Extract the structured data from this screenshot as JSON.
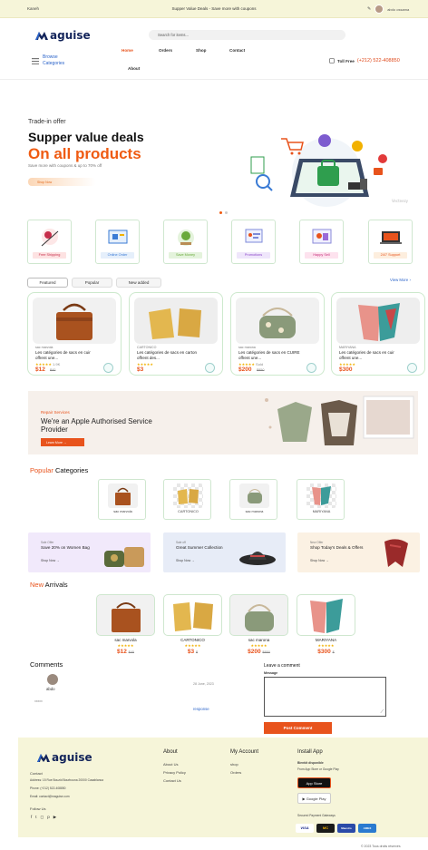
{
  "topbar": {
    "language": "Kaneh",
    "promo": "Supper Value Deals - Save more with coupons",
    "user_name": "abdo ossama"
  },
  "header": {
    "brand": "aguise",
    "search_placeholder": "Search for items...",
    "browse_label": "Browse Categories",
    "nav": [
      "Home",
      "Orders",
      "Shop",
      "Contact",
      "About"
    ],
    "toll_label": "Toll Free",
    "toll_number": "(+212) 522-408850"
  },
  "hero": {
    "eyebrow": "Trade-in offer",
    "title": "Supper value deals",
    "highlight": "On all products",
    "subtitle": "Save more with coupons & up to 70% off",
    "button": "Shop Now",
    "watermark": "Vecteezy"
  },
  "services": [
    "Free Shipping",
    "Online Order",
    "Save Money",
    "Promotions",
    "Happy Sell",
    "24/7 Support"
  ],
  "tabs": [
    "Featured",
    "Popular",
    "New added"
  ],
  "view_more": "View More",
  "products": [
    {
      "brand": "sac marvola",
      "name": "Les catégories de sacs en cuir offrent une...",
      "rating": "1.9K",
      "price": "$12",
      "old_price": "$40"
    },
    {
      "brand": "CARTONICO",
      "name": "Les catégories de sacs en carton offrent des...",
      "rating": "",
      "price": "$3",
      "old_price": ""
    },
    {
      "brand": "sac marona",
      "name": "Les catégories de sacs en CUIRE offrent une...",
      "rating": "Sold",
      "price": "$200",
      "old_price": "$850"
    },
    {
      "brand": "MARIYANA",
      "name": "Les catégories de sacs en cuir offrent une...",
      "rating": "",
      "price": "$300",
      "old_price": ""
    }
  ],
  "banner": {
    "eyebrow": "Repair Services",
    "title": "We're an Apple Authorised Service Provider",
    "button": "Learn More"
  },
  "popular": {
    "accent": "Popular",
    "rest": " Categories",
    "items": [
      "sac marvola",
      "CARTONICO",
      "sac marona",
      "MARIYANA"
    ]
  },
  "promos": [
    {
      "eyebrow": "Sale Offer",
      "title": "Save 20% on Women Bag",
      "link": "Shop Now"
    },
    {
      "eyebrow": "Sale off",
      "title": "Great Summer Collection",
      "link": "Shop Now"
    },
    {
      "eyebrow": "New Offer",
      "title": "Shop Today's Deals & Offers",
      "link": "Shop Now"
    }
  ],
  "arrivals": {
    "accent": "New",
    "rest": " Arrivals",
    "items": [
      {
        "name": "sac marvola",
        "price": "$12",
        "old": "$40"
      },
      {
        "name": "CARTONICO",
        "price": "$3",
        "old": "$"
      },
      {
        "name": "sac marona",
        "price": "$200",
        "old": "$850"
      },
      {
        "name": "MARIYANA",
        "price": "$300",
        "old": "$"
      }
    ]
  },
  "comments": {
    "title": "Comments",
    "author": "abdo",
    "date": "28 June, 2023",
    "text": "xxxxx",
    "reply": "response"
  },
  "leave_comment": {
    "title": "Leave a comment",
    "message_label": "Message",
    "button": "Post Comment"
  },
  "footer": {
    "brand": "aguise",
    "contact_h": "Contact",
    "address": "Address: 15 Rue Bouzid Bourbouna 20000 Casablanca",
    "phone": "Phone: (+212) 522-408850",
    "email": "Email: contact@maguise.com",
    "follow": "Follow Us",
    "about_h": "About",
    "about_links": [
      "About Us",
      "Privacy Policy",
      "Contact Us"
    ],
    "account_h": "My Account",
    "account_links": [
      "shop",
      "Orders"
    ],
    "install_h": "Install App",
    "install_sub": "Bientôt disponible",
    "install_note": "From App Store or Google Play",
    "app_store": "App Store",
    "google_play": "Google Play",
    "payment": "Secured Payment Gateways",
    "cards": [
      "VISA",
      "MC",
      "Maestro",
      "AMEX"
    ]
  },
  "copyright": "© 2023 Tous droits réservés"
}
